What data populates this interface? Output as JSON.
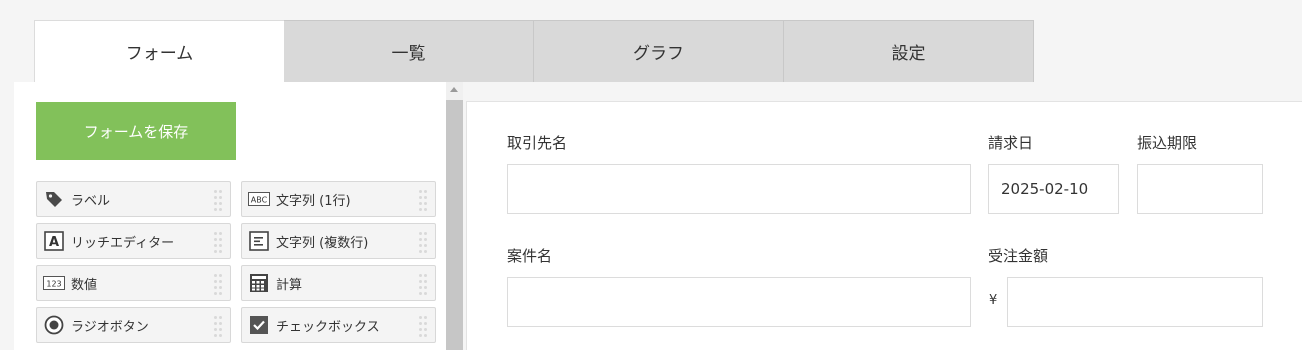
{
  "tabs": [
    {
      "label": "フォーム",
      "active": true
    },
    {
      "label": "一覧",
      "active": false
    },
    {
      "label": "グラフ",
      "active": false
    },
    {
      "label": "設定",
      "active": false
    }
  ],
  "palette": {
    "save_label": "フォームを保存",
    "save_color": "#82c15a",
    "items": [
      {
        "label": "ラベル",
        "icon": "tag-icon"
      },
      {
        "label": "文字列 (1行)",
        "icon": "abc-icon"
      },
      {
        "label": "リッチエディター",
        "icon": "letter-a-icon"
      },
      {
        "label": "文字列 (複数行)",
        "icon": "multiline-text-icon"
      },
      {
        "label": "数値",
        "icon": "number-icon"
      },
      {
        "label": "計算",
        "icon": "calculator-icon"
      },
      {
        "label": "ラジオボタン",
        "icon": "radio-icon"
      },
      {
        "label": "チェックボックス",
        "icon": "checkbox-icon"
      }
    ]
  },
  "form": {
    "client_label": "取引先名",
    "client_value": "",
    "invoice_date_label": "請求日",
    "invoice_date_value": "2025-02-10",
    "due_label": "振込期限",
    "due_value": "",
    "project_label": "案件名",
    "project_value": "",
    "amount_label": "受注金額",
    "currency_symbol": "¥",
    "amount_value": ""
  }
}
